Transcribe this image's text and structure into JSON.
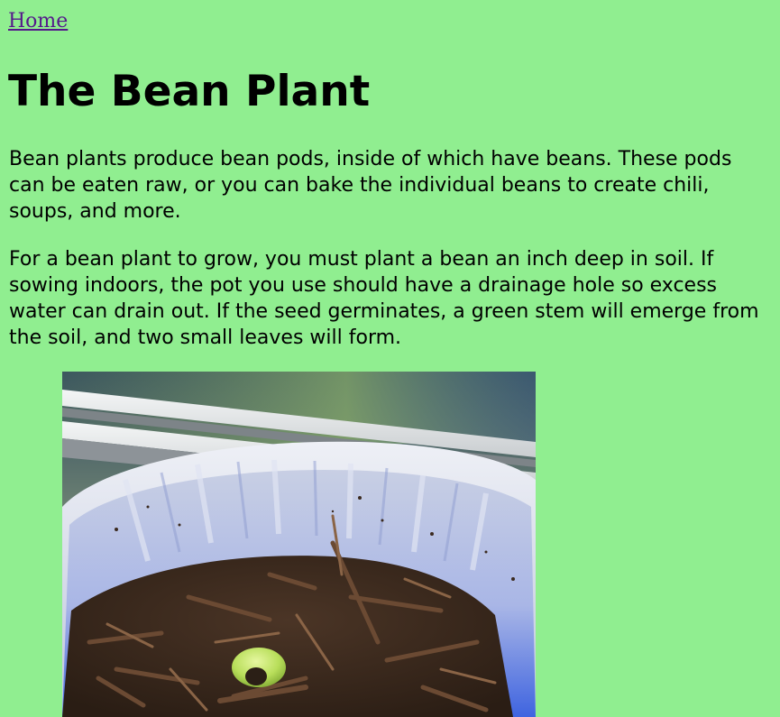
{
  "nav": {
    "home_label": "Home"
  },
  "page": {
    "title": "The Bean Plant",
    "paragraphs": [
      "Bean plants produce bean pods, inside of which have beans. These pods can be eaten raw, or you can bake the individual beans to create chili, soups, and more.",
      "For a bean plant to grow, you must plant a bean an inch deep in soil. If sowing indoors, the pot you use should have a drainage hole so excess water can drain out. If the seed germinates, a green stem will emerge from the soil, and two small leaves will form."
    ]
  },
  "image": {
    "subject": "bean-sprout-in-white-pot-photo"
  },
  "colors": {
    "background": "#90ee90",
    "link": "#551a8b",
    "text": "#000000"
  }
}
